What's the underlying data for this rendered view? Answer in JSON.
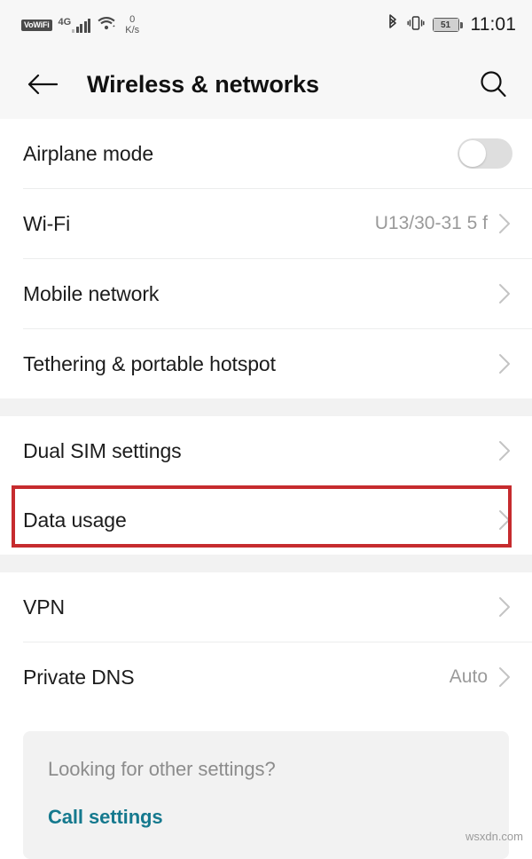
{
  "statusbar": {
    "vowifi_badge": "VoWiFi",
    "network_type": "4G",
    "signal_bars": 5,
    "data_speed_value": "0",
    "data_speed_unit": "K/s",
    "battery_percent": "51",
    "time": "11:01",
    "icons": [
      "vowifi-icon",
      "signal-bars-icon",
      "wifi-icon",
      "bluetooth-icon",
      "vibrate-icon",
      "battery-icon"
    ]
  },
  "appbar": {
    "title": "Wireless & networks",
    "back_icon": "back-arrow-icon",
    "search_icon": "search-icon"
  },
  "sections": [
    {
      "rows": [
        {
          "label": "Airplane mode",
          "value": "",
          "control": "switch",
          "switch_on": false
        },
        {
          "label": "Wi-Fi",
          "value": "U13/30-31 5 f",
          "control": "chevron"
        },
        {
          "label": "Mobile network",
          "value": "",
          "control": "chevron"
        },
        {
          "label": "Tethering & portable hotspot",
          "value": "",
          "control": "chevron"
        }
      ]
    },
    {
      "rows": [
        {
          "label": "Dual SIM settings",
          "value": "",
          "control": "chevron"
        },
        {
          "label": "Data usage",
          "value": "",
          "control": "chevron",
          "highlighted": true
        }
      ]
    },
    {
      "rows": [
        {
          "label": "VPN",
          "value": "",
          "control": "chevron"
        },
        {
          "label": "Private DNS",
          "value": "Auto",
          "control": "chevron"
        }
      ]
    }
  ],
  "footer": {
    "prompt": "Looking for other settings?",
    "link_label": "Call settings"
  },
  "watermark": "wsxdn.com",
  "colors": {
    "highlight": "#c62b2e",
    "link": "#15798e",
    "chrome_bg": "#f7f7f7",
    "section_gap": "#f2f2f2",
    "value_text": "#9a9a9a"
  }
}
